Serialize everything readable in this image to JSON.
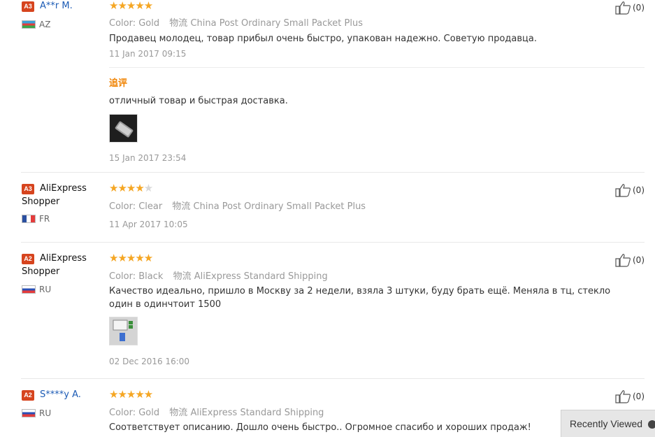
{
  "reviews": [
    {
      "level": "A3",
      "name": "A**r M.",
      "country": "AZ",
      "stars": 5,
      "color_label": "Color:",
      "color": "Gold",
      "ship_label": "物流",
      "shipping": "China Post Ordinary Small Packet Plus",
      "text": "Продавец молодец, товар прибыл очень быстро, упакован надежно. Советую продавца.",
      "date": "11 Jan 2017 09:15",
      "followup_label": "追评",
      "followup_text": "отличный товар и быстрая доставка.",
      "followup_date": "15 Jan 2017 23:54",
      "likes": "(0)"
    },
    {
      "level": "A3",
      "name": "AliExpress Shopper",
      "country": "FR",
      "stars": 4,
      "color_label": "Color:",
      "color": "Clear",
      "ship_label": "物流",
      "shipping": "China Post Ordinary Small Packet Plus",
      "date": "11 Apr 2017 10:05",
      "likes": "(0)"
    },
    {
      "level": "A2",
      "name": "AliExpress Shopper",
      "country": "RU",
      "stars": 5,
      "color_label": "Color:",
      "color": "Black",
      "ship_label": "物流",
      "shipping": "AliExpress Standard Shipping",
      "text": "Качество идеально, пришло в Москву за 2 недели, взяла 3 штуки, буду брать ещё. Меняла в тц, стекло один в одинчтоит 1500",
      "date": "02 Dec 2016 16:00",
      "likes": "(0)"
    },
    {
      "level": "A2",
      "name": "S****y A.",
      "country": "RU",
      "stars": 5,
      "color_label": "Color:",
      "color": "Gold",
      "ship_label": "物流",
      "shipping": "AliExpress Standard Shipping",
      "text": "Соответствует описанию. Дошло очень быстро.. Огромное спасибо и хороших продаж!",
      "likes": "(0)"
    }
  ],
  "recently_viewed": {
    "label": "Recently Viewed",
    "icon": "chevron-up-icon"
  },
  "colors": {
    "accent_link": "#1c5bb5",
    "badge": "#d6441e",
    "star": "#f5a623",
    "followup": "#f08200"
  }
}
